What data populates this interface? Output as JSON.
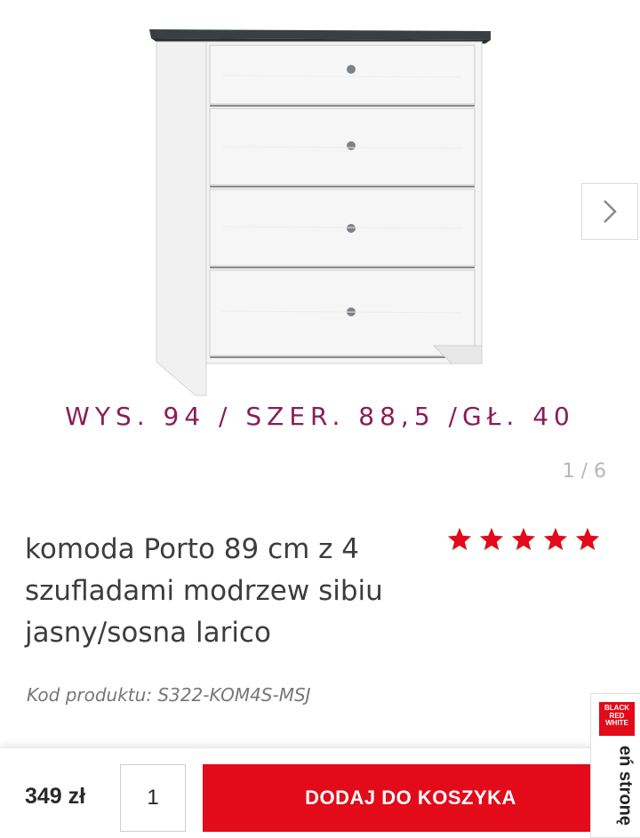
{
  "product": {
    "dimensions_label": "WYS. 94 / SZER. 88,5 /GŁ. 40",
    "gallery_counter": "1 / 6",
    "title": "komoda Porto 89 cm z 4 szufladami modrzew sibiu jasny/sosna larico",
    "rating": 5,
    "code_label": "Kod produktu: S322-KOM4S-MSJ"
  },
  "purchase": {
    "price": "349 zł",
    "quantity": "1",
    "add_to_cart_label": "DODAJ DO KOSZYKA"
  },
  "side_tab": {
    "logo_lines": [
      "BLACK",
      "RED",
      "WHITE"
    ],
    "text": "eń stronę"
  },
  "colors": {
    "accent_red": "#e30a19",
    "dimensions_purple": "#8a1d56",
    "star_red": "#e30a19"
  },
  "icons": {
    "next": "chevron-right-icon",
    "star": "star-icon"
  }
}
